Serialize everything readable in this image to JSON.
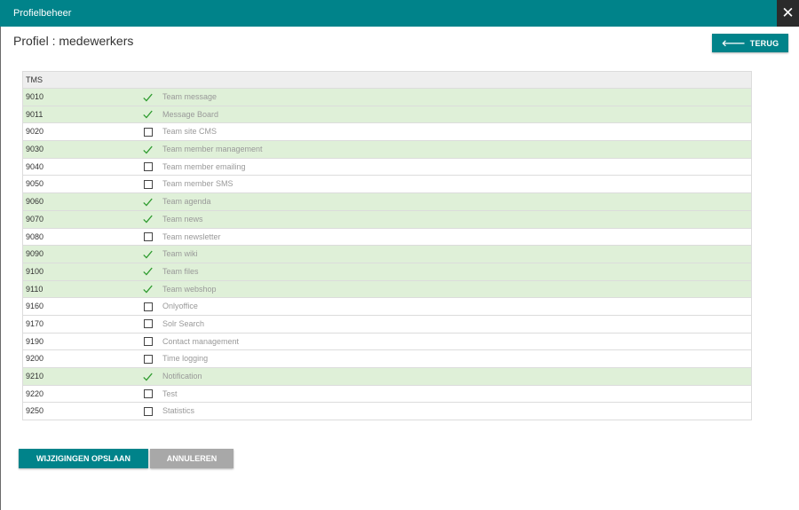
{
  "header": {
    "title": "Profielbeheer",
    "close_label": "✕"
  },
  "page_title": "Profiel : medewerkers",
  "back_button": {
    "label": "TERUG"
  },
  "table": {
    "header": "TMS",
    "rows": [
      {
        "code": "9010",
        "label": "Team message",
        "checked": true
      },
      {
        "code": "9011",
        "label": "Message Board",
        "checked": true
      },
      {
        "code": "9020",
        "label": "Team site CMS",
        "checked": false
      },
      {
        "code": "9030",
        "label": "Team member management",
        "checked": true
      },
      {
        "code": "9040",
        "label": "Team member emailing",
        "checked": false
      },
      {
        "code": "9050",
        "label": "Team member SMS",
        "checked": false
      },
      {
        "code": "9060",
        "label": "Team agenda",
        "checked": true
      },
      {
        "code": "9070",
        "label": "Team news",
        "checked": true
      },
      {
        "code": "9080",
        "label": "Team newsletter",
        "checked": false
      },
      {
        "code": "9090",
        "label": "Team wiki",
        "checked": true
      },
      {
        "code": "9100",
        "label": "Team files",
        "checked": true
      },
      {
        "code": "9110",
        "label": "Team webshop",
        "checked": true
      },
      {
        "code": "9160",
        "label": "Onlyoffice",
        "checked": false
      },
      {
        "code": "9170",
        "label": "Solr Search",
        "checked": false
      },
      {
        "code": "9190",
        "label": "Contact management",
        "checked": false
      },
      {
        "code": "9200",
        "label": "Time logging",
        "checked": false
      },
      {
        "code": "9210",
        "label": "Notification",
        "checked": true
      },
      {
        "code": "9220",
        "label": "Test",
        "checked": false
      },
      {
        "code": "9250",
        "label": "Statistics",
        "checked": false
      }
    ]
  },
  "footer": {
    "save_label": "WIJZIGINGEN OPSLAAN",
    "cancel_label": "ANNULEREN"
  },
  "colors": {
    "accent": "#00838a",
    "checked_row": "#dff0d8",
    "checkmark": "#2e9b2e",
    "cancel": "#a8a8a8"
  }
}
